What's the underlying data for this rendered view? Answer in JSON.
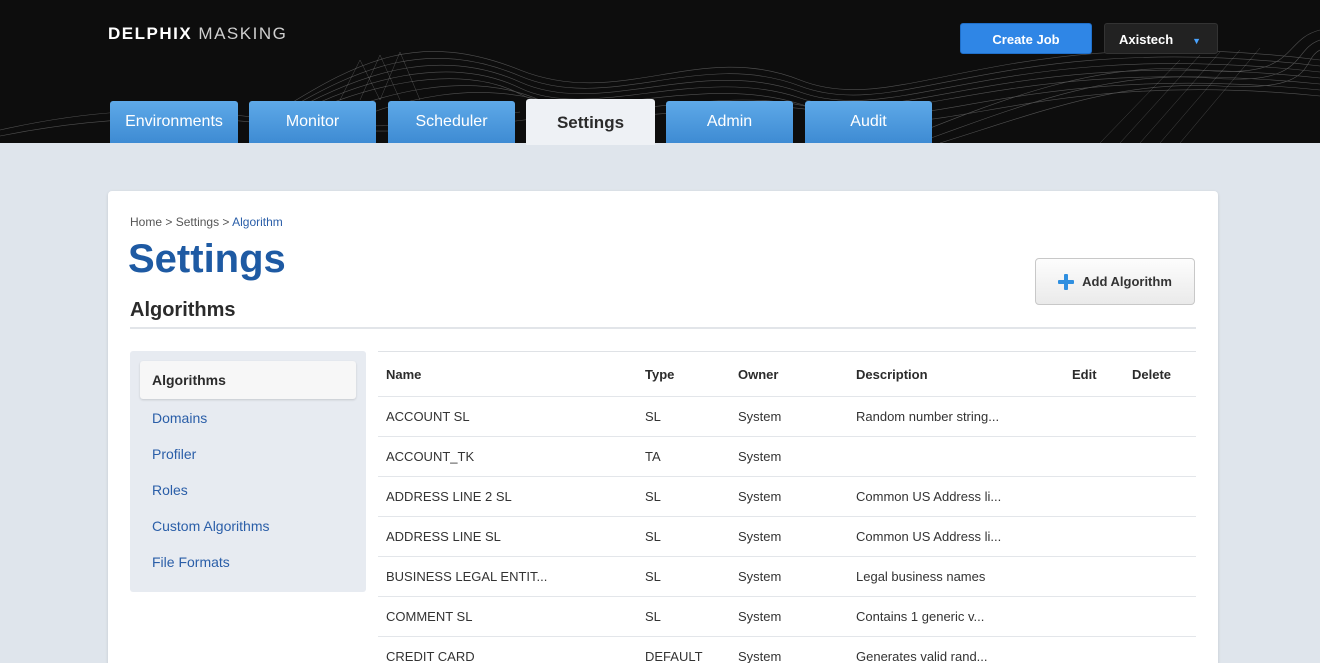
{
  "brand": {
    "bold": "DELPHIX",
    "light": "MASKING"
  },
  "header": {
    "create_job_label": "Create Job",
    "user_name": "Axistech"
  },
  "tabs": [
    {
      "label": "Environments"
    },
    {
      "label": "Monitor"
    },
    {
      "label": "Scheduler"
    },
    {
      "label": "Settings",
      "active": true
    },
    {
      "label": "Admin"
    },
    {
      "label": "Audit"
    }
  ],
  "breadcrumb": {
    "home": "Home",
    "settings": "Settings",
    "current": "Algorithm",
    "separator": ">"
  },
  "page_title": "Settings",
  "section_title": "Algorithms",
  "add_button_label": "Add Algorithm",
  "sidenav": {
    "items": [
      {
        "label": "Algorithms",
        "active": true
      },
      {
        "label": "Domains"
      },
      {
        "label": "Profiler"
      },
      {
        "label": "Roles"
      },
      {
        "label": "Custom Algorithms"
      },
      {
        "label": "File Formats"
      }
    ]
  },
  "table": {
    "headers": {
      "name": "Name",
      "type": "Type",
      "owner": "Owner",
      "description": "Description",
      "edit": "Edit",
      "delete": "Delete"
    },
    "rows": [
      {
        "name": "ACCOUNT SL",
        "type": "SL",
        "owner": "System",
        "description": "Random number string..."
      },
      {
        "name": "ACCOUNT_TK",
        "type": "TA",
        "owner": "System",
        "description": ""
      },
      {
        "name": "ADDRESS LINE 2 SL",
        "type": "SL",
        "owner": "System",
        "description": "Common US Address li..."
      },
      {
        "name": "ADDRESS LINE SL",
        "type": "SL",
        "owner": "System",
        "description": "Common US Address li..."
      },
      {
        "name": "BUSINESS LEGAL ENTIT...",
        "type": "SL",
        "owner": "System",
        "description": "Legal business names"
      },
      {
        "name": "COMMENT SL",
        "type": "SL",
        "owner": "System",
        "description": "Contains 1 generic v..."
      },
      {
        "name": "CREDIT CARD",
        "type": "DEFAULT",
        "owner": "System",
        "description": "Generates valid rand..."
      }
    ]
  },
  "colors": {
    "accent": "#2f86e6",
    "tab": "#4a98dc",
    "title": "#1e5aa3",
    "link": "#2a5ea8"
  }
}
